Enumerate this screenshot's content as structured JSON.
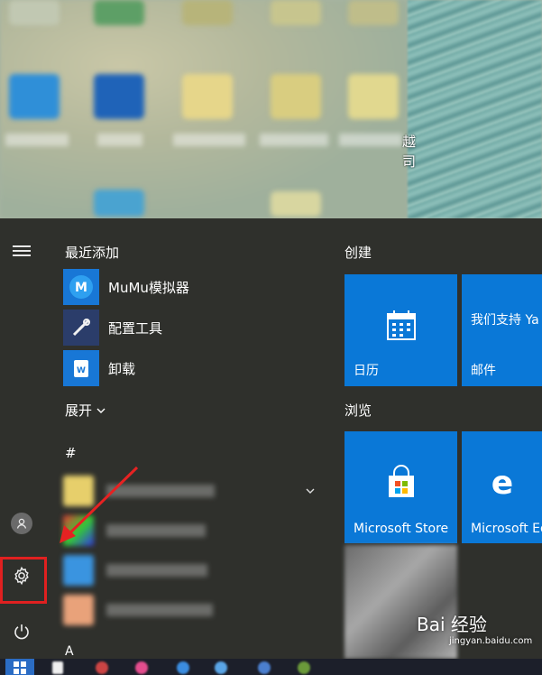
{
  "desktop": {
    "edge_text": [
      "越",
      "司"
    ]
  },
  "rail": {
    "menu_icon": "hamburger-icon",
    "account_icon": "user-icon",
    "settings_icon": "gear-icon",
    "power_icon": "power-icon"
  },
  "list": {
    "recently_added_title": "最近添加",
    "apps": [
      {
        "label": "MuMu模拟器",
        "icon": "mumu-icon"
      },
      {
        "label": "配置工具",
        "icon": "tools-icon"
      },
      {
        "label": "卸载",
        "icon": "uninstall-icon"
      }
    ],
    "expand_label": "展开",
    "hash_header": "#",
    "bottom_header": "A"
  },
  "tiles": {
    "create_title": "创建",
    "browse_title": "浏览",
    "calendar_label": "日历",
    "mail_top_text": "我们支持 Ya",
    "mail_label": "邮件",
    "store_label": "Microsoft Store",
    "edge_label": "Microsoft Ed"
  },
  "watermark": {
    "text": "Bai 经验",
    "url": "jingyan.baidu.com"
  },
  "colors": {
    "tile_blue": "#0a78d7",
    "menu_bg": "#2f302c",
    "highlight_red": "#e02020"
  }
}
